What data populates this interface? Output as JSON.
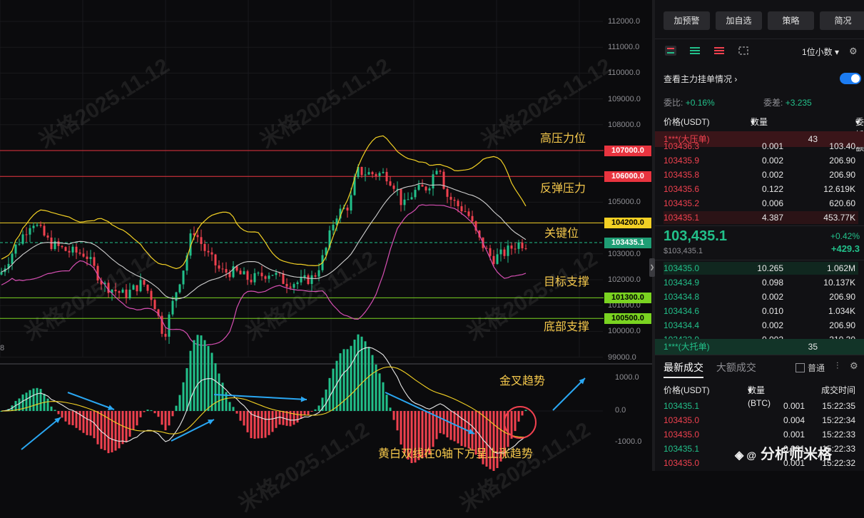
{
  "chart": {
    "price_ticks": [
      "112000.0",
      "111000.0",
      "110000.0",
      "109000.0",
      "108000.0",
      "107000.0",
      "106000.0",
      "105000.0",
      "104200.0",
      "103000.0",
      "102000.0",
      "101000.0",
      "100000.0",
      "99000.0"
    ],
    "macd_ticks": [
      "1000.0",
      "0.0",
      "-1000.0"
    ],
    "left_fragment": "8",
    "levels": [
      {
        "value": "107000.0",
        "label": "高压力位",
        "color": "#e8343f",
        "badge_bg": "#e8343f",
        "badge_fg": "#ffffff"
      },
      {
        "value": "106000.0",
        "label": "反弹压力",
        "color": "#e8343f",
        "badge_bg": "#e8343f",
        "badge_fg": "#ffffff"
      },
      {
        "value": "104200.0",
        "label": "关键位",
        "color": "#f2d024",
        "badge_bg": "#f2d024",
        "badge_fg": "#000000"
      },
      {
        "value": "103435.1",
        "label": "",
        "color": "#22c08a",
        "badge_bg": "#1f9e75",
        "badge_fg": "#ffffff"
      },
      {
        "value": "101300.0",
        "label": "目标支撑",
        "color": "#7ad321",
        "badge_bg": "#7ad321",
        "badge_fg": "#000000"
      },
      {
        "value": "100500.0",
        "label": "底部支撑",
        "color": "#7ad321",
        "badge_bg": "#7ad321",
        "badge_fg": "#000000"
      }
    ],
    "macd_annotations": {
      "golden_cross": "金叉趋势",
      "description": "黄白双线在0轴下方呈上涨趋势"
    },
    "watermark": "米格2025.11.12",
    "colors": {
      "up": "#22c08a",
      "down": "#f0414f",
      "mid_band": "#cfcfcf",
      "upper_band": "#f2d024",
      "lower_band": "#d64fb3",
      "macd_dif": "#e8e8e8",
      "macd_dea": "#f2d024",
      "arrow": "#2aa7f2"
    }
  },
  "panel": {
    "buttons": [
      "加预警",
      "加自选",
      "策略",
      "简况"
    ],
    "precision": "1位小数",
    "main_orders_label": "查看主力挂单情况",
    "ratio": {
      "label": "委比:",
      "value": "+0.16%",
      "diff_label": "委差:",
      "diff_value": "+3.235"
    },
    "book_headers": {
      "price": "价格(USDT)",
      "qty": "数量 (BTC)",
      "amount": "委托额"
    },
    "big_ask": {
      "name": "1***(大压单)",
      "value": "43"
    },
    "asks": [
      {
        "price": "103436.3",
        "qty": "0.001",
        "amount": "103.40"
      },
      {
        "price": "103435.9",
        "qty": "0.002",
        "amount": "206.90"
      },
      {
        "price": "103435.8",
        "qty": "0.002",
        "amount": "206.90"
      },
      {
        "price": "103435.6",
        "qty": "0.122",
        "amount": "12.619K"
      },
      {
        "price": "103435.2",
        "qty": "0.006",
        "amount": "620.60"
      },
      {
        "price": "103435.1",
        "qty": "4.387",
        "amount": "453.77K"
      }
    ],
    "last_price": "103,435.1",
    "last_price_sub": "$103,435.1",
    "change_pct": "+0.42%",
    "change_abs": "+429.3",
    "bids": [
      {
        "price": "103435.0",
        "qty": "10.265",
        "amount": "1.062M"
      },
      {
        "price": "103434.9",
        "qty": "0.098",
        "amount": "10.137K"
      },
      {
        "price": "103434.8",
        "qty": "0.002",
        "amount": "206.90"
      },
      {
        "price": "103434.6",
        "qty": "0.010",
        "amount": "1.034K"
      },
      {
        "price": "103434.4",
        "qty": "0.002",
        "amount": "206.90"
      },
      {
        "price": "103433.9",
        "qty": "0.002",
        "amount": "210.30"
      }
    ],
    "big_bid": {
      "name": "1***(大托单)",
      "value": "35"
    },
    "trades_tabs": [
      "最新成交",
      "大额成交"
    ],
    "normal_label": "普通",
    "trade_headers": {
      "price": "价格(USDT)",
      "qty": "数量(BTC)",
      "time": "成交时间"
    },
    "trades": [
      {
        "price": "103435.1",
        "qty": "0.001",
        "time": "15:22:35",
        "side": "buy"
      },
      {
        "price": "103435.0",
        "qty": "0.004",
        "time": "15:22:34",
        "side": "sell"
      },
      {
        "price": "103435.0",
        "qty": "0.001",
        "time": "15:22:33",
        "side": "sell"
      },
      {
        "price": "103435.1",
        "qty": "0.001",
        "time": "15:22:33",
        "side": "buy"
      },
      {
        "price": "103435.0",
        "qty": "0.001",
        "time": "15:22:32",
        "side": "sell"
      }
    ],
    "author": "分析师米格"
  }
}
